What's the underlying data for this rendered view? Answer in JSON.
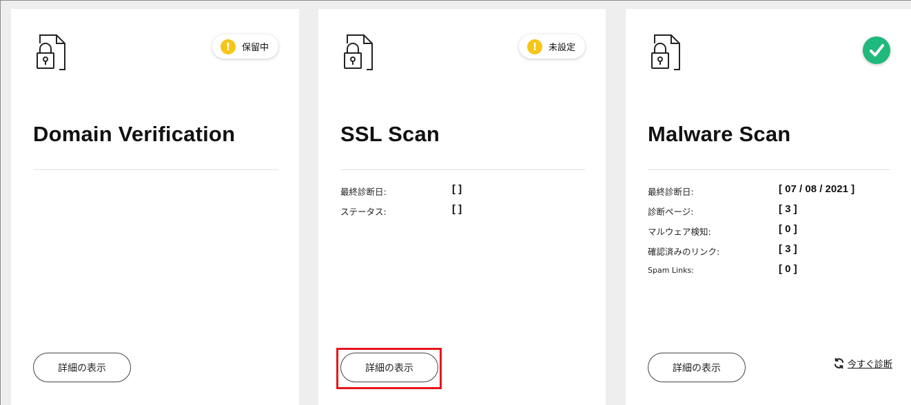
{
  "cards": [
    {
      "title": "Domain Verification",
      "status": {
        "type": "warning",
        "label": "保留中",
        "icon": "exclamation-icon",
        "color": "#f5c518"
      },
      "rows": [],
      "button_label": "詳細の表示"
    },
    {
      "title": "SSL Scan",
      "status": {
        "type": "warning",
        "label": "未設定",
        "icon": "exclamation-icon",
        "color": "#f5c518"
      },
      "rows": [
        {
          "label": "最終診断日:",
          "value": "[ ]"
        },
        {
          "label": "ステータス:",
          "value": "[ ]"
        }
      ],
      "button_label": "詳細の表示",
      "highlighted": true
    },
    {
      "title": "Malware Scan",
      "status": {
        "type": "ok",
        "icon": "check-icon",
        "color": "#1fb97b"
      },
      "rows": [
        {
          "label": "最終診断日:",
          "value": "[ 07 / 08 / 2021 ]"
        },
        {
          "label": "診断ページ:",
          "value": "[ 3 ]"
        },
        {
          "label": "マルウェア検知:",
          "value": "[ 0 ]"
        },
        {
          "label": "確認済みのリンク:",
          "value": "[ 3 ]"
        },
        {
          "label": "Spam Links:",
          "value": "[ 0 ]"
        }
      ],
      "button_label": "詳細の表示",
      "rescan_label": "今すぐ診断",
      "rescan_icon": "refresh-icon"
    }
  ],
  "highlight_color": "#e8141a",
  "card_icon": "file-lock-icon"
}
